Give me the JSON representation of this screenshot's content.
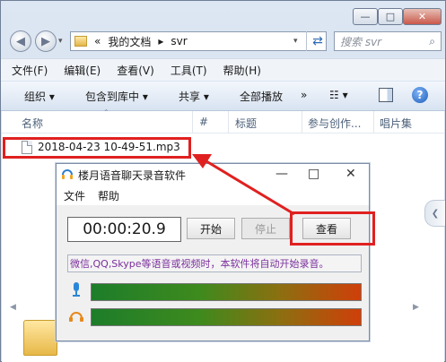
{
  "explorer": {
    "address": {
      "prefix": "«",
      "folder": "我的文档",
      "sep": "▸",
      "current": "svr"
    },
    "search_placeholder": "搜索 svr",
    "window_controls": {
      "minimize": "—",
      "maximize": "□",
      "close": "✕"
    },
    "menu": [
      "文件(F)",
      "编辑(E)",
      "查看(V)",
      "工具(T)",
      "帮助(H)"
    ],
    "toolbar": {
      "organize": "组织 ▾",
      "include": "包含到库中 ▾",
      "share": "共享 ▾",
      "playall": "全部播放",
      "more": "»",
      "views": "☷ ▾"
    },
    "columns": {
      "name": "名称",
      "number": "#",
      "title": "标题",
      "artists": "参与创作...",
      "album": "唱片集"
    },
    "file": "2018-04-23 10-49-51.mp3"
  },
  "app": {
    "title": "楼月语音聊天录音软件",
    "menu": {
      "file": "文件",
      "help": "帮助"
    },
    "controls": {
      "min": "—",
      "max": "□",
      "close": "✕"
    },
    "timer": "00:00:20.9",
    "buttons": {
      "start": "开始",
      "stop": "停止",
      "view": "查看"
    },
    "notice": "微信,QQ,Skype等语音或视频时，本软件将自动开始录音。"
  },
  "colors": {
    "highlight": "#e02020",
    "notice_text": "#7a2f9c",
    "meter_start": "#1d7d2a",
    "meter_end": "#cf3f09"
  },
  "icons": [
    "back-icon",
    "forward-icon",
    "folder-icon",
    "refresh-icon",
    "search-icon",
    "help-icon",
    "file-icon",
    "microphone-icon",
    "headphones-icon",
    "logo-icon"
  ]
}
